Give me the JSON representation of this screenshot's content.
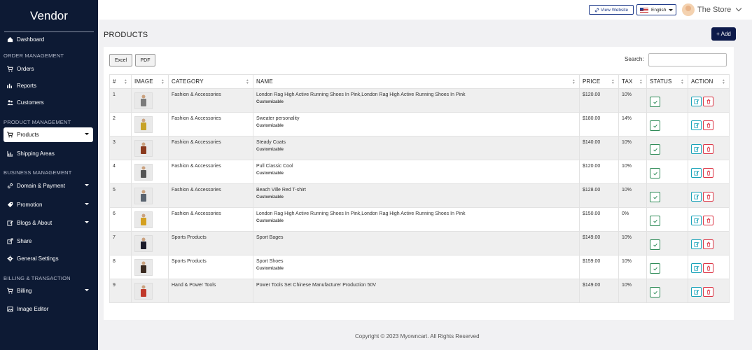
{
  "sidebar": {
    "brand": "Vendor",
    "items": [
      {
        "label": "Dashboard",
        "icon": "dashboard-icon"
      },
      {
        "label": "Orders",
        "icon": "cart-icon"
      },
      {
        "label": "Reports",
        "icon": "reports-icon"
      },
      {
        "label": "Customers",
        "icon": "users-icon"
      },
      {
        "label": "Products",
        "icon": "cart-icon",
        "active": true
      },
      {
        "label": "Shipping Areas",
        "icon": "chart-icon"
      },
      {
        "label": "Domain & Payment",
        "icon": "link-icon"
      },
      {
        "label": "Promotion",
        "icon": "tag-icon"
      },
      {
        "label": "Blogs & About",
        "icon": "edit-icon"
      },
      {
        "label": "Share",
        "icon": "share-icon"
      },
      {
        "label": "General Settings",
        "icon": "gear-icon"
      },
      {
        "label": "Billing",
        "icon": "cart-icon"
      },
      {
        "label": "Image Editor",
        "icon": "image-icon"
      }
    ],
    "headings": [
      "ORDER MANAGEMENT",
      "PRODUCT MANAGEMENT",
      "BUSINESS MANAGEMENT",
      "BILLING & TRANSACTION"
    ]
  },
  "topbar": {
    "view_website": "View Website",
    "language": "English",
    "store_name": "The Store"
  },
  "page": {
    "title": "PRODUCTS",
    "add_label": "+ Add"
  },
  "toolbar": {
    "excel": "Excel",
    "pdf": "PDF",
    "search_label": "Search:",
    "search_value": ""
  },
  "table": {
    "headers": [
      "#",
      "IMAGE",
      "CATEGORY",
      "NAME",
      "PRICE",
      "TAX",
      "STATUS",
      "ACTION"
    ],
    "rows": [
      {
        "num": "1",
        "category": "Fashion & Accessories",
        "name": "London Rag High Active Running Shoes In Pink,London Rag High Active Running Shoes In Pink",
        "sub": "Customizable",
        "price": "$120.00",
        "tax": "10%"
      },
      {
        "num": "2",
        "category": "Fashion & Accessories",
        "name": "Sweater personality",
        "sub": "Customizable",
        "price": "$180.00",
        "tax": "14%"
      },
      {
        "num": "3",
        "category": "Fashion & Accessories",
        "name": "Steady Coats",
        "sub": "Customizable",
        "price": "$140.00",
        "tax": "10%"
      },
      {
        "num": "4",
        "category": "Fashion & Accessories",
        "name": "Pull Classic Cool",
        "sub": "Customizable",
        "price": "$120.00",
        "tax": "10%"
      },
      {
        "num": "5",
        "category": "Fashion & Accessories",
        "name": "Beach Ville Red T-shirt",
        "sub": "Customizable",
        "price": "$128.00",
        "tax": "10%"
      },
      {
        "num": "6",
        "category": "Fashion & Accessories",
        "name": "London Rag High Active Running Shoes In Pink,London Rag High Active Running Shoes In Pink",
        "sub": "Customizable",
        "price": "$150.00",
        "tax": "0%"
      },
      {
        "num": "7",
        "category": "Sports Products",
        "name": "Sport Bages",
        "sub": "",
        "price": "$149.00",
        "tax": "10%"
      },
      {
        "num": "8",
        "category": "Sports Products",
        "name": "Sport Shoes",
        "sub": "Customizable",
        "price": "$159.00",
        "tax": "10%"
      },
      {
        "num": "9",
        "category": "Hand & Power Tools",
        "name": "Power Tools Set Chinese Manufacturer Production 50V",
        "sub": "",
        "price": "$149.00",
        "tax": "10%"
      }
    ]
  },
  "footer": "Copyright © 2023 Myowncart. All Rights Reserved",
  "colors": {
    "sidebar": "#0d1a34",
    "accent": "#0d1a4a",
    "status_green": "#2e8b57",
    "edit_cyan": "#17a2b8",
    "delete_red": "#dc3545"
  }
}
